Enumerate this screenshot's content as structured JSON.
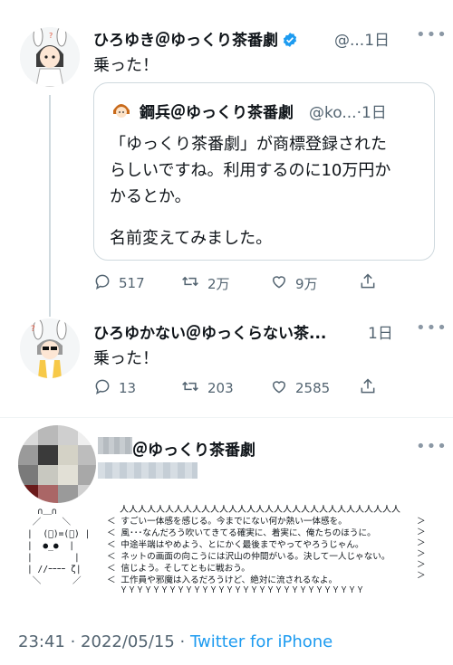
{
  "tweet1": {
    "name": "ひろゆき＠ゆっくり茶番劇",
    "handle": "@...",
    "time": "1日",
    "text": "乗った！"
  },
  "quote": {
    "name": "鋼兵＠ゆっくり茶番劇",
    "handle": "@ko...",
    "time": "1日",
    "line1": "「ゆっくり茶番劇」が商標登録された",
    "line2": "らしいですね。利用するのに10万円か",
    "line3": "かるとか。",
    "line4": "名前変えてみました。"
  },
  "tweet1_actions": {
    "replies": "517",
    "retweets": "2万",
    "likes": "9万"
  },
  "tweet2": {
    "name": "ひろゆかない＠ゆっくらない茶...",
    "time": "1日",
    "text": "乗った！"
  },
  "tweet2_actions": {
    "replies": "13",
    "retweets": "203",
    "likes": "2585"
  },
  "main": {
    "name_suffix": "＠ゆっくり茶番劇",
    "aa_face": [
      "  ∩＿∩",
      " ／    ＼",
      "|  (ﾟ)=(ﾟ) |",
      "|  ●_●  |",
      "|        |",
      "| //ｰｰｰｰ ζ|",
      " ＼      ／"
    ],
    "aa_top": "人人人人人人人人人人人人人人人人人人人人人人人人人人人人人人人",
    "aa_lines": [
      "＜ すごい一体感を感じる。今までにない何か熱い一体感を。",
      "＜ 風･･･なんだろう吹いてきてる確実に、着実に、俺たちのほうに。",
      "＜ 中途半端はやめよう、とにかく最後までやってやろうじゃん。",
      "＜ ネットの画面の向こうには沢山の仲間がいる。決して一人じゃない。",
      "＜ 信じよう。そしてともに戦おう。",
      "＜ 工作員や邪魔は入るだろうけど、絶対に流されるなよ。"
    ],
    "aa_bottom": "ＹＹＹＹＹＹＹＹＹＹＹＹＹＹＹＹＹＹＹＹＹＹＹＹＹＹＹＹＹＹ",
    "timestamp": "23:41 · 2022/05/15 · ",
    "source": "Twitter for iPhone"
  },
  "icons": {
    "more": "more-horizontal-icon",
    "reply": "reply-icon",
    "retweet": "retweet-icon",
    "like": "heart-icon",
    "share": "share-icon",
    "verified": "verified-badge-icon"
  },
  "colors": {
    "link": "#1d9bf0",
    "verified": "#1d9bf0",
    "muted": "#536471"
  }
}
